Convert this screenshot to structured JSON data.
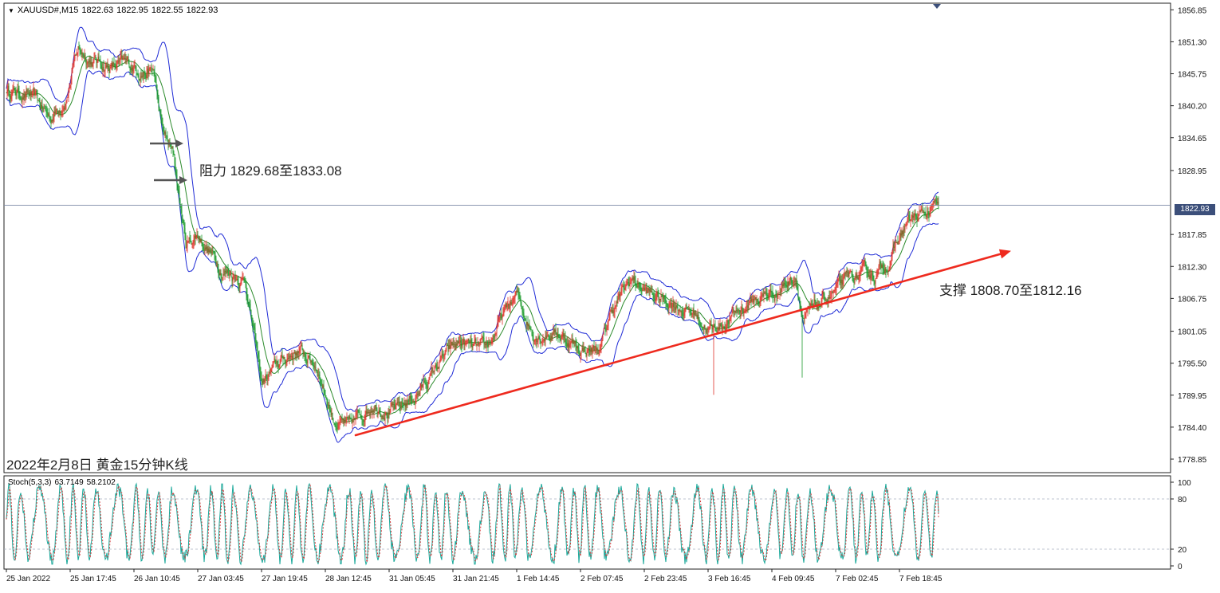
{
  "header": {
    "symbol": "XAUUSD#,M15",
    "open": "1822.63",
    "high": "1822.95",
    "low": "1822.55",
    "close": "1822.93"
  },
  "annotations": {
    "resistance": "阻力 1829.68至1833.08",
    "support": "支撑 1808.70至1812.16",
    "caption": "2022年2月8日 黄金15分钟K线"
  },
  "stoch": {
    "label": "Stoch(5,3,3)",
    "k": "63.7149",
    "d": "58.2102"
  },
  "current_price": "1822.93",
  "colors": {
    "bollinger": "#1f2bd6",
    "trendline": "#ee2a1e",
    "bull_candle": "#e0322a",
    "bear_candle": "#1a9a2a",
    "ma": "#2a8a2a",
    "stoch_k": "#1aa89a",
    "stoch_d": "#d23a3a",
    "grid": "#a8b0c0",
    "price_box": "#3c4f7a"
  },
  "chart_data": [
    {
      "type": "candlestick",
      "title": "XAUUSD#,M15",
      "ylim": [
        1776.5,
        1858.0
      ],
      "y_ticks": [
        "1856.85",
        "1851.30",
        "1845.75",
        "1840.20",
        "1834.65",
        "1828.95",
        "1822.93",
        "1817.85",
        "1812.30",
        "1806.75",
        "1801.05",
        "1795.50",
        "1789.95",
        "1784.40",
        "1778.85"
      ],
      "x_ticks": [
        "25 Jan 2022",
        "25 Jan 17:45",
        "26 Jan 10:45",
        "27 Jan 03:45",
        "27 Jan 19:45",
        "28 Jan 12:45",
        "31 Jan 05:45",
        "31 Jan 21:45",
        "1 Feb 14:45",
        "2 Feb 07:45",
        "2 Feb 23:45",
        "3 Feb 16:45",
        "4 Feb 09:45",
        "7 Feb 02:45",
        "7 Feb 18:45"
      ],
      "x_tick_index": [
        0,
        80,
        160,
        240,
        320,
        400,
        480,
        560,
        640,
        720,
        800,
        880,
        960,
        1040,
        1120
      ],
      "n_bars": 1170,
      "approx_close_path": [
        {
          "i": 0,
          "y": 1843
        },
        {
          "i": 30,
          "y": 1842
        },
        {
          "i": 55,
          "y": 1838
        },
        {
          "i": 75,
          "y": 1842
        },
        {
          "i": 90,
          "y": 1850
        },
        {
          "i": 110,
          "y": 1848
        },
        {
          "i": 130,
          "y": 1847
        },
        {
          "i": 160,
          "y": 1847
        },
        {
          "i": 185,
          "y": 1846
        },
        {
          "i": 195,
          "y": 1836
        },
        {
          "i": 210,
          "y": 1831
        },
        {
          "i": 225,
          "y": 1816
        },
        {
          "i": 240,
          "y": 1818
        },
        {
          "i": 270,
          "y": 1812
        },
        {
          "i": 300,
          "y": 1810
        },
        {
          "i": 320,
          "y": 1792
        },
        {
          "i": 340,
          "y": 1795
        },
        {
          "i": 365,
          "y": 1798
        },
        {
          "i": 390,
          "y": 1795
        },
        {
          "i": 410,
          "y": 1786
        },
        {
          "i": 430,
          "y": 1784
        },
        {
          "i": 460,
          "y": 1789
        },
        {
          "i": 490,
          "y": 1787
        },
        {
          "i": 520,
          "y": 1791
        },
        {
          "i": 545,
          "y": 1796
        },
        {
          "i": 570,
          "y": 1799
        },
        {
          "i": 600,
          "y": 1797
        },
        {
          "i": 620,
          "y": 1803
        },
        {
          "i": 640,
          "y": 1807
        },
        {
          "i": 660,
          "y": 1801
        },
        {
          "i": 690,
          "y": 1801
        },
        {
          "i": 720,
          "y": 1798
        },
        {
          "i": 745,
          "y": 1798
        },
        {
          "i": 760,
          "y": 1805
        },
        {
          "i": 785,
          "y": 1810
        },
        {
          "i": 810,
          "y": 1807
        },
        {
          "i": 840,
          "y": 1806
        },
        {
          "i": 865,
          "y": 1804
        },
        {
          "i": 885,
          "y": 1801
        },
        {
          "i": 905,
          "y": 1803
        },
        {
          "i": 930,
          "y": 1806
        },
        {
          "i": 965,
          "y": 1808
        },
        {
          "i": 990,
          "y": 1811
        },
        {
          "i": 1000,
          "y": 1803
        },
        {
          "i": 1010,
          "y": 1804
        },
        {
          "i": 1030,
          "y": 1807
        },
        {
          "i": 1060,
          "y": 1810
        },
        {
          "i": 1090,
          "y": 1811
        },
        {
          "i": 1110,
          "y": 1814
        },
        {
          "i": 1130,
          "y": 1820
        },
        {
          "i": 1150,
          "y": 1821
        },
        {
          "i": 1169,
          "y": 1822.93
        }
      ],
      "spikes": [
        {
          "i": 887,
          "low": 1790
        },
        {
          "i": 998,
          "low": 1793
        }
      ],
      "trendline": {
        "from": {
          "i": 438,
          "y": 1783
        },
        "to": {
          "i": 1260,
          "y": 1815
        }
      },
      "current_price_line": 1822.93
    },
    {
      "type": "line",
      "title": "Stoch(5,3,3)",
      "ylim": [
        0,
        100
      ],
      "y_ticks": [
        0,
        20,
        80,
        100
      ],
      "levels": [
        20,
        80
      ],
      "series": [
        {
          "name": "K",
          "last": 63.7149
        },
        {
          "name": "D",
          "last": 58.2102
        }
      ]
    }
  ]
}
